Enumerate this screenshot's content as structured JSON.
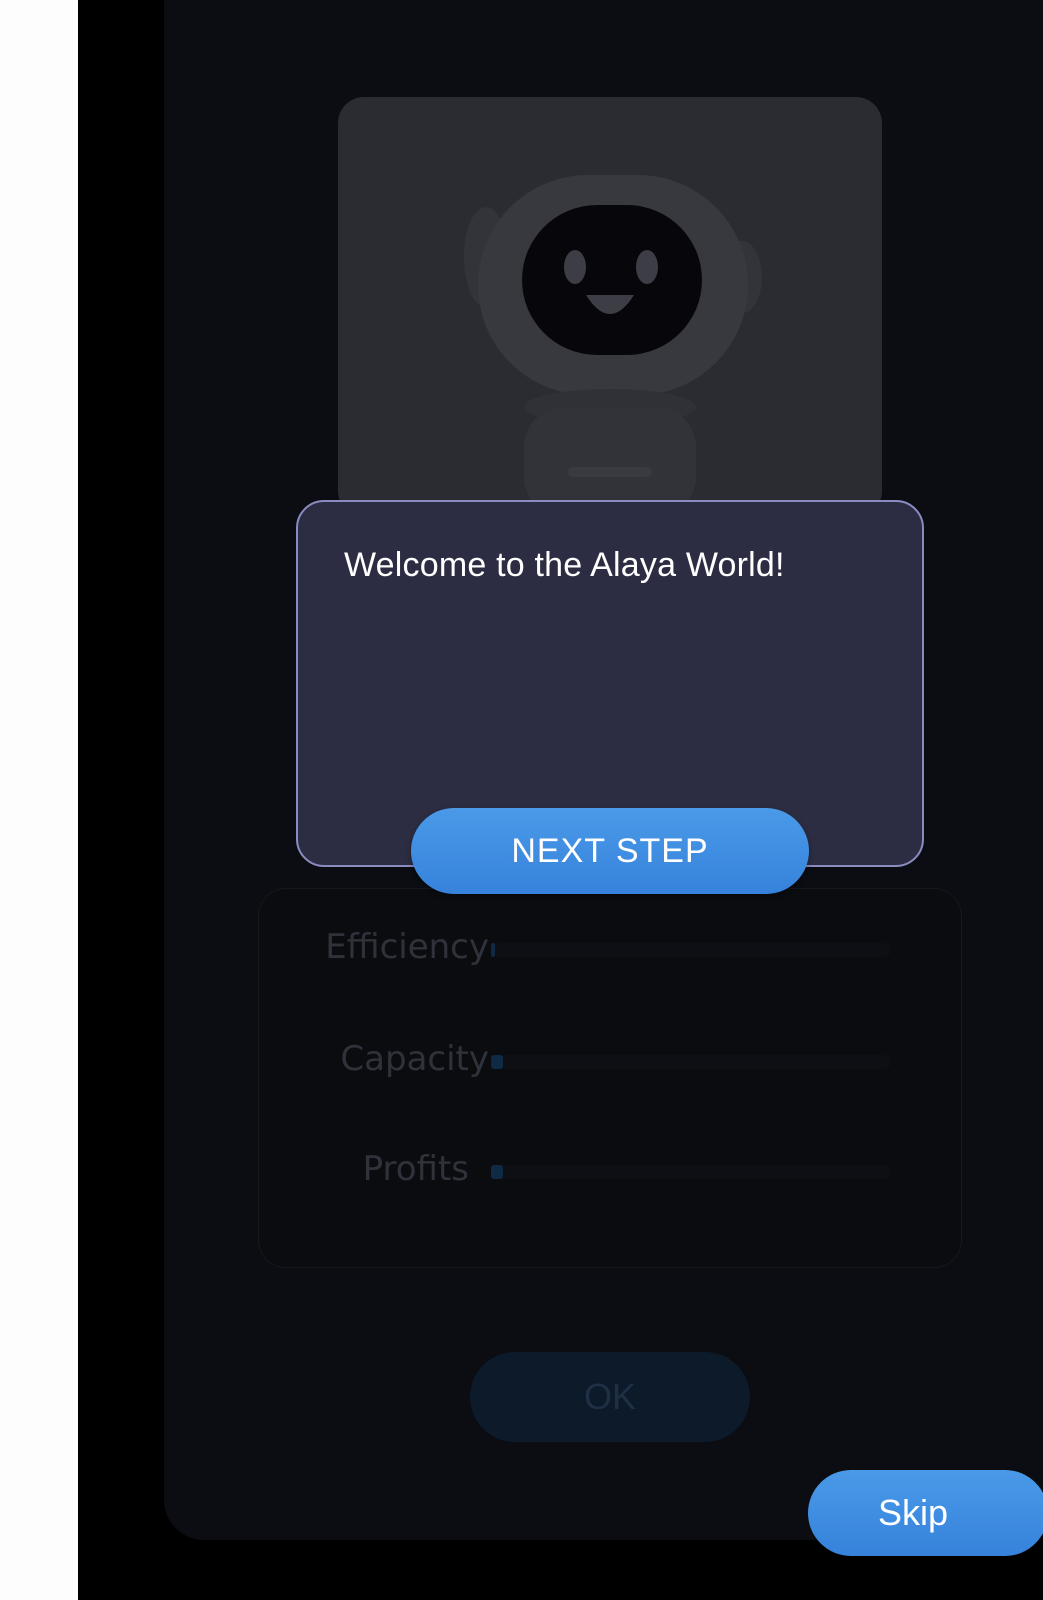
{
  "onboarding": {
    "welcome_message": "Welcome to the Alaya World!",
    "next_step_label": "NEXT STEP",
    "skip_label": "Skip"
  },
  "hero": {
    "icon": "robot-mascot-icon"
  },
  "stats": {
    "items": [
      {
        "label": "Efficiency",
        "value": 0.01
      },
      {
        "label": "Capacity",
        "value": 0.03
      },
      {
        "label": "Profits",
        "value": 0.03
      }
    ]
  },
  "actions": {
    "ok_label": "OK"
  },
  "colors": {
    "accent": "#3b8be2",
    "dialog_bg": "#2c2d42",
    "dialog_border": "#8a8bc0",
    "card_bg": "#0b0d12"
  }
}
